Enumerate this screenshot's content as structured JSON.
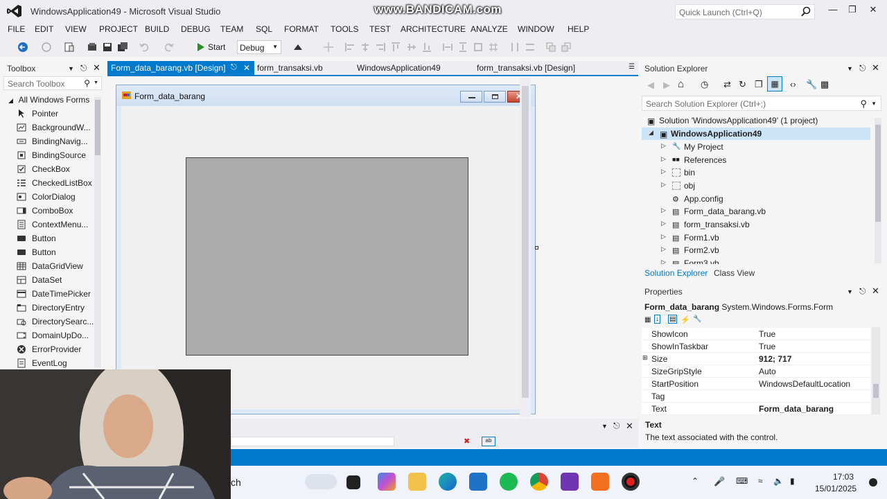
{
  "window": {
    "title": "WindowsApplication49 - Microsoft Visual Studio",
    "watermark": "www.BANDICAM.com",
    "quick_launch_placeholder": "Quick Launch (Ctrl+Q)"
  },
  "menu": [
    "FILE",
    "EDIT",
    "VIEW",
    "PROJECT",
    "BUILD",
    "DEBUG",
    "TEAM",
    "SQL",
    "FORMAT",
    "TOOLS",
    "TEST",
    "ARCHITECTURE",
    "ANALYZE",
    "WINDOW",
    "HELP"
  ],
  "toolbar": {
    "start_label": "Start",
    "configuration": "Debug"
  },
  "toolbox": {
    "title": "Toolbox",
    "search_placeholder": "Search Toolbox",
    "group": "All Windows Forms",
    "items": [
      "Pointer",
      "BackgroundW...",
      "BindingNavig...",
      "BindingSource",
      "CheckBox",
      "CheckedListBox",
      "ColorDialog",
      "ComboBox",
      "ContextMenu...",
      "Button",
      "Button",
      "DataGridView",
      "DataSet",
      "DateTimePicker",
      "DirectoryEntry",
      "DirectorySearc...",
      "DomainUpDo...",
      "ErrorProvider",
      "EventLog"
    ]
  },
  "editor_tabs": [
    "Form_data_barang.vb [Design]",
    "form_transaksi.vb",
    "WindowsApplication49",
    "form_transaksi.vb [Design]"
  ],
  "designer": {
    "form_title": "Form_data_barang"
  },
  "solution_explorer": {
    "title": "Solution Explorer",
    "search_placeholder": "Search Solution Explorer (Ctrl+;)",
    "solution": "Solution 'WindowsApplication49' (1 project)",
    "project": "WindowsApplication49",
    "items": [
      "My Project",
      "References",
      "bin",
      "obj",
      "App.config",
      "Form_data_barang.vb",
      "form_transaksi.vb",
      "Form1.vb",
      "Form2.vb",
      "Form3.vb"
    ],
    "tabs": [
      "Solution Explorer",
      "Class View"
    ]
  },
  "properties": {
    "title": "Properties",
    "object_name": "Form_data_barang",
    "object_type": "System.Windows.Forms.Form",
    "rows": [
      {
        "name": "ShowIcon",
        "value": "True"
      },
      {
        "name": "ShowInTaskbar",
        "value": "True"
      },
      {
        "name": "Size",
        "value": "912; 717"
      },
      {
        "name": "SizeGripStyle",
        "value": "Auto"
      },
      {
        "name": "StartPosition",
        "value": "WindowsDefaultLocation"
      },
      {
        "name": "Tag",
        "value": ""
      },
      {
        "name": "Text",
        "value": "Form_data_barang"
      }
    ],
    "description_title": "Text",
    "description": "The text associated with the control."
  },
  "taskbar": {
    "search_text": "ch",
    "time": "17:03",
    "date": "15/01/2025"
  },
  "colors": {
    "accent": "#007acc",
    "designer_panel": "#ababab"
  }
}
